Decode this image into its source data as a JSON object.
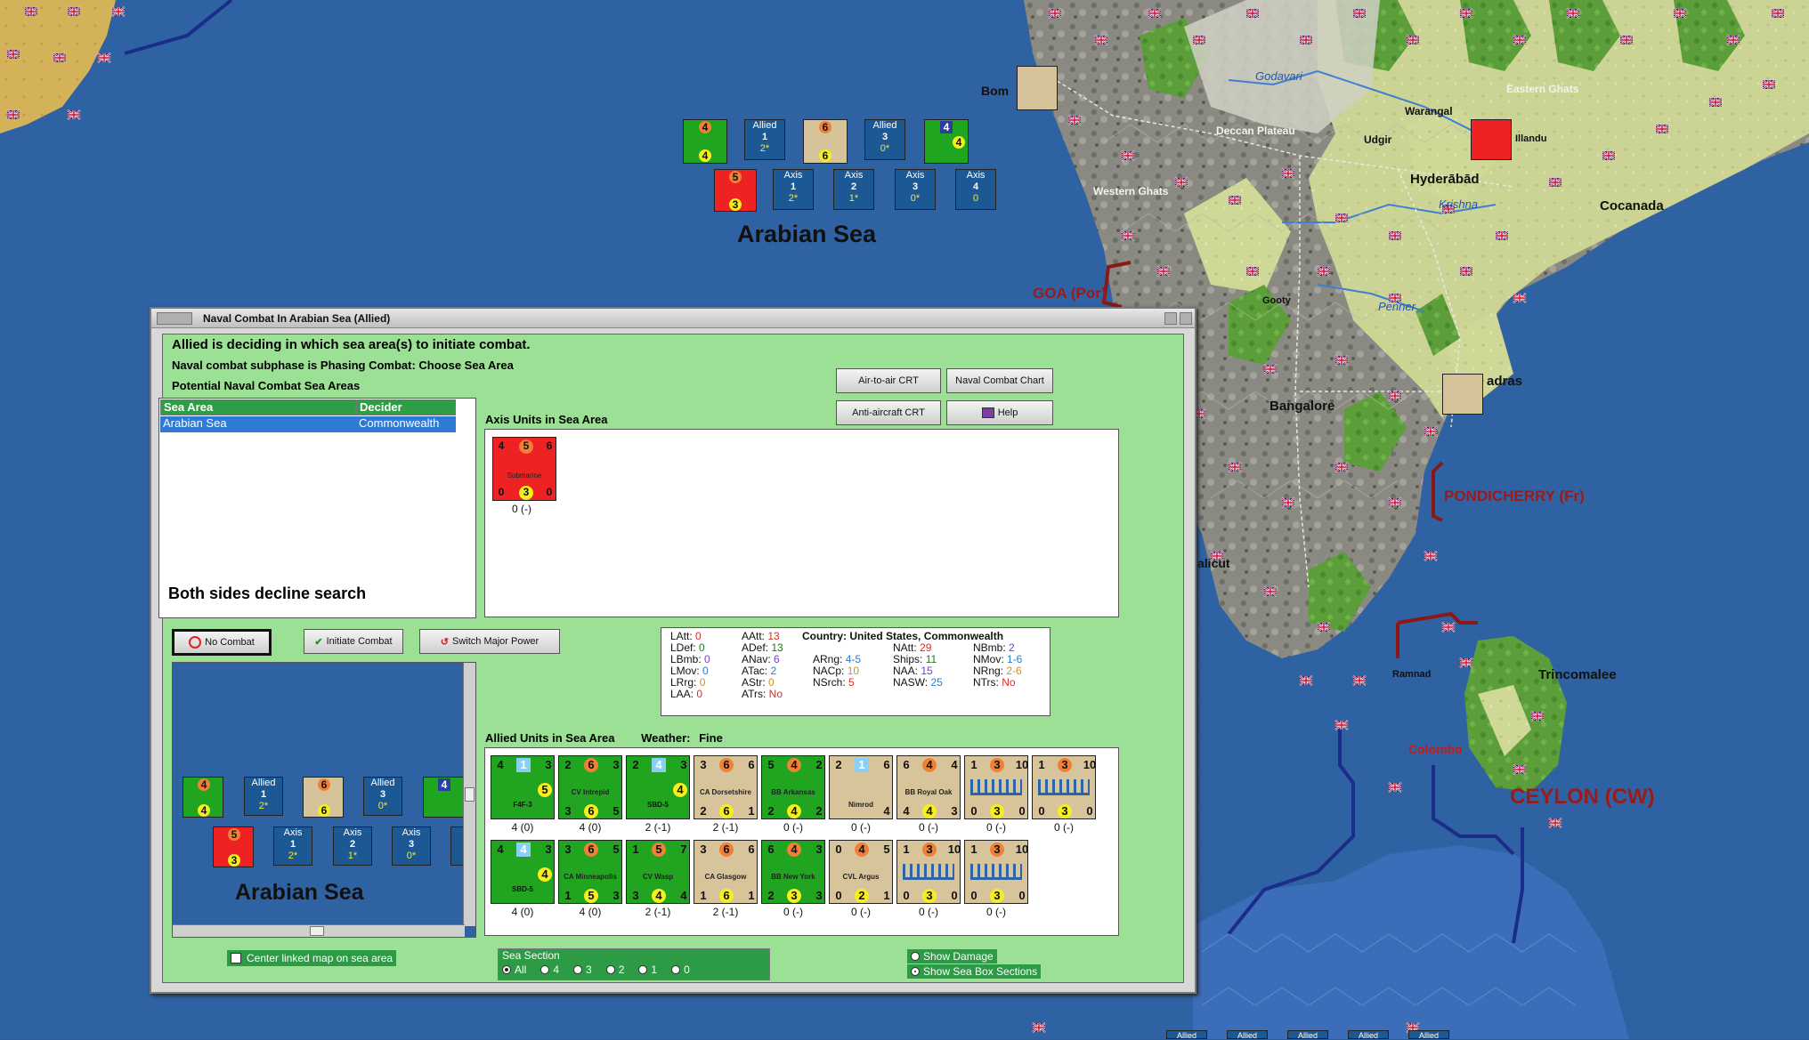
{
  "window": {
    "title": "Naval Combat In Arabian Sea (Allied)",
    "line1": "Allied is deciding in which sea area(s) to initiate combat.",
    "line2": "Naval combat subphase is Phasing Combat: Choose Sea Area",
    "line3": "Potential Naval Combat Sea Areas"
  },
  "buttons": {
    "air_to_air": "Air-to-air CRT",
    "naval_chart": "Naval Combat Chart",
    "anti_aircraft": "Anti-aircraft CRT",
    "help": "Help",
    "no_combat": "No Combat",
    "initiate": "Initiate Combat",
    "switch": "Switch Major Power"
  },
  "sea_table": {
    "headers": [
      "Sea Area",
      "Decider"
    ],
    "rows": [
      [
        "Arabian Sea",
        "Commonwealth"
      ]
    ],
    "message": "Both sides decline search"
  },
  "axis_units": {
    "header": "Axis Units in Sea Area",
    "units": [
      {
        "name": "Submarine",
        "top": [
          "4",
          "5",
          "6"
        ],
        "bottom": [
          "0",
          "3",
          "0"
        ],
        "label": "0 (-)"
      }
    ]
  },
  "stats": {
    "country_label": "Country:",
    "country": "United States, Commonwealth",
    "col1": [
      [
        "LAtt:",
        "0"
      ],
      [
        "LDef:",
        "0"
      ],
      [
        "LBmb:",
        "0"
      ],
      [
        "LMov:",
        "0"
      ],
      [
        "LRrg:",
        "0"
      ],
      [
        "LAA:",
        "0"
      ]
    ],
    "col2": [
      [
        "AAtt:",
        "13"
      ],
      [
        "ADef:",
        "13"
      ],
      [
        "ANav:",
        "6"
      ],
      [
        "ATac:",
        "2"
      ],
      [
        "AStr:",
        "0"
      ],
      [
        "ATrs:",
        "No"
      ]
    ],
    "col3": [
      [
        "ARng:",
        "4-5"
      ],
      [
        "NACp:",
        "10"
      ],
      [
        "NSrch:",
        "5"
      ]
    ],
    "col4": [
      [
        "NAtt:",
        "29"
      ],
      [
        "Ships:",
        "11"
      ],
      [
        "NAA:",
        "15"
      ],
      [
        "NASW:",
        "25"
      ]
    ],
    "col5": [
      [
        "NBmb:",
        "2"
      ],
      [
        "NMov:",
        "1-6"
      ],
      [
        "NRng:",
        "2-6"
      ],
      [
        "NTrs:",
        "No"
      ]
    ]
  },
  "allied_units": {
    "header": "Allied Units in Sea Area",
    "weather_label": "Weather:",
    "weather": "Fine",
    "row1": [
      {
        "name": "F4F-3",
        "kind": "air",
        "tl": "4",
        "tm": "1",
        "tr": "3",
        "bl": "",
        "bm": "",
        "br": "5",
        "label": "4 (0)"
      },
      {
        "name": "CV Intrepid",
        "kind": "green",
        "tl": "2",
        "tm": "6",
        "tr": "3",
        "bl": "3",
        "bm": "6",
        "br": "5",
        "label": "4 (0)"
      },
      {
        "name": "SBD-5",
        "kind": "air",
        "tl": "2",
        "tm": "4",
        "tr": "3",
        "bl": "",
        "bm": "",
        "br": "4",
        "label": "2 (-1)"
      },
      {
        "name": "CA Dorsetshire",
        "kind": "tan",
        "tl": "3",
        "tm": "6",
        "tr": "6",
        "bl": "2",
        "bm": "6",
        "br": "1",
        "label": "2 (-1)"
      },
      {
        "name": "BB Arkansas",
        "kind": "green",
        "tl": "5",
        "tm": "4",
        "tr": "2",
        "bl": "2",
        "bm": "4",
        "br": "2",
        "label": "0 (-)"
      },
      {
        "name": "Nimrod",
        "kind": "tanair",
        "tl": "2",
        "tm": "1",
        "tr": "6",
        "bl": "",
        "bm": "",
        "br": "4",
        "label": "0 (-)"
      },
      {
        "name": "BB Royal Oak",
        "kind": "tan",
        "tl": "6",
        "tm": "4",
        "tr": "4",
        "bl": "4",
        "bm": "4",
        "br": "3",
        "label": "0 (-)"
      },
      {
        "name": "",
        "kind": "white",
        "tl": "1",
        "tm": "3",
        "tr": "10",
        "bl": "0",
        "bm": "3",
        "br": "0",
        "label": "0 (-)"
      },
      {
        "name": "",
        "kind": "white",
        "tl": "1",
        "tm": "3",
        "tr": "10",
        "bl": "0",
        "bm": "3",
        "br": "0",
        "label": "0 (-)"
      }
    ],
    "row2": [
      {
        "name": "SBD-5",
        "kind": "air",
        "tl": "4",
        "tm": "4",
        "tr": "3",
        "bl": "",
        "bm": "",
        "br": "4",
        "label": "4 (0)"
      },
      {
        "name": "CA Minneapolis",
        "kind": "green",
        "tl": "3",
        "tm": "6",
        "tr": "5",
        "bl": "1",
        "bm": "5",
        "br": "3",
        "label": "4 (0)"
      },
      {
        "name": "CV Wasp",
        "kind": "green",
        "tl": "1",
        "tm": "5",
        "tr": "7",
        "bl": "3",
        "bm": "4",
        "br": "4",
        "label": "2 (-1)"
      },
      {
        "name": "CA Glasgow",
        "kind": "tan",
        "tl": "3",
        "tm": "6",
        "tr": "6",
        "bl": "1",
        "bm": "6",
        "br": "1",
        "label": "2 (-1)"
      },
      {
        "name": "BB New York",
        "kind": "green",
        "tl": "6",
        "tm": "4",
        "tr": "3",
        "bl": "2",
        "bm": "3",
        "br": "3",
        "label": "0 (-)"
      },
      {
        "name": "CVL Argus",
        "kind": "tan",
        "tl": "0",
        "tm": "4",
        "tr": "5",
        "bl": "0",
        "bm": "2",
        "br": "1",
        "label": "0 (-)"
      },
      {
        "name": "",
        "kind": "white",
        "tl": "1",
        "tm": "3",
        "tr": "10",
        "bl": "0",
        "bm": "3",
        "br": "0",
        "label": "0 (-)"
      },
      {
        "name": "",
        "kind": "white",
        "tl": "1",
        "tm": "3",
        "tr": "10",
        "bl": "0",
        "bm": "3",
        "br": "0",
        "label": "0 (-)"
      }
    ]
  },
  "minimap": {
    "label": "Arabian Sea",
    "allied_boxes": [
      [
        "Allied",
        "1",
        "2*"
      ],
      [
        "Allied",
        "3",
        "0*"
      ]
    ],
    "axis_boxes": [
      [
        "Axis",
        "1",
        "2*"
      ],
      [
        "Axis",
        "2",
        "1*"
      ],
      [
        "Axis",
        "3",
        "0*"
      ],
      [
        "A",
        "",
        ""
      ]
    ],
    "checkbox_label": "Center linked map on sea area"
  },
  "sea_section": {
    "label": "Sea Section",
    "options": [
      "All",
      "4",
      "3",
      "2",
      "1",
      "0"
    ],
    "selected": "All"
  },
  "toggles": {
    "show_damage": "Show Damage",
    "show_boxes": "Show Sea Box Sections"
  },
  "map": {
    "sea_label": "Arabian Sea",
    "allied_boxes": [
      [
        "Allied",
        "1",
        "2*"
      ],
      [
        "Allied",
        "3",
        "0*"
      ]
    ],
    "axis_boxes": [
      [
        "Axis",
        "1",
        "2*"
      ],
      [
        "Axis",
        "2",
        "1*"
      ],
      [
        "Axis",
        "3",
        "0*"
      ],
      [
        "Axis",
        "4",
        "0"
      ]
    ],
    "places": {
      "bombay": "Bom",
      "goa": "GOA (Por)",
      "pondicherry": "PONDICHERRY (Fr)",
      "ceylon": "CEYLON (CW)",
      "colombo": "Colombo",
      "trincomalee": "Trincomalee",
      "hyderabad": "Hyderābād",
      "cocanada": "Cocanada",
      "bangalore": "Bangalore",
      "madras": "adras",
      "calicut": "alicut",
      "warangal": "Warangal",
      "udgir": "Udgir",
      "godavari": "Godavari",
      "krishna": "Krishna",
      "penner": "Penner",
      "gooty": "Gooty",
      "western_ghats": "Western Ghats",
      "eastern_ghats": "Eastern Ghats",
      "deccan": "Deccan Plateau",
      "ramnad": "Ramnad",
      "illandu": "Illandu"
    },
    "bottom_boxes": [
      "Allied",
      "Allied",
      "Allied",
      "Allied",
      "Allied"
    ]
  }
}
